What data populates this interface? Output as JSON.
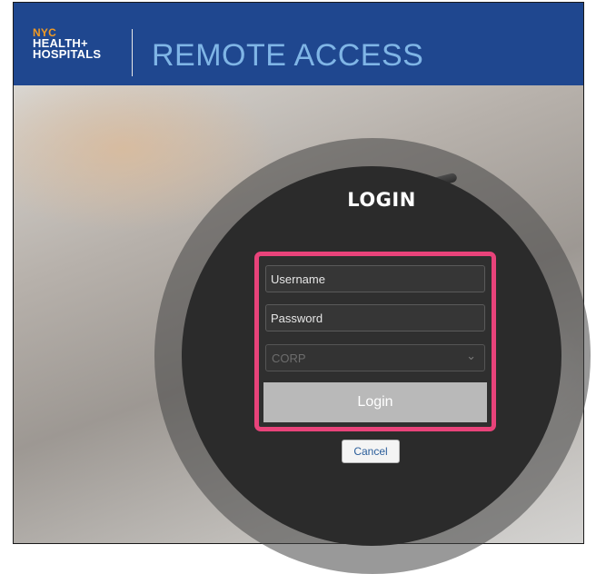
{
  "header": {
    "logo": {
      "line1": "NYC",
      "line2": "HEALTH+",
      "line3": "HOSPITALS"
    },
    "title": "REMOTE ACCESS"
  },
  "login": {
    "heading": "LOGIN",
    "username_placeholder": "Username",
    "password_placeholder": "Password",
    "domain_selected": "CORP",
    "login_button": "Login",
    "cancel_button": "Cancel"
  },
  "colors": {
    "header_bg": "#1f478f",
    "title": "#7fb5e6",
    "logo_accent": "#f29a23",
    "highlight_border": "#e8437a"
  }
}
